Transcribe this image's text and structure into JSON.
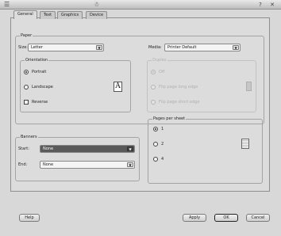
{
  "window": {
    "app_icon": "☃",
    "help_symbol": "?",
    "close_symbol": "✕"
  },
  "tabs": [
    {
      "label": "General",
      "active": true
    },
    {
      "label": "Text",
      "active": false
    },
    {
      "label": "Graphics",
      "active": false
    },
    {
      "label": "Device",
      "active": false
    }
  ],
  "paper": {
    "title": "Paper",
    "size_label": "Size:",
    "size_value": "Letter",
    "media_label": "Media:",
    "media_value": "Printer Default"
  },
  "orientation": {
    "title": "Orientation",
    "portrait": "Portrait",
    "landscape": "Landscape",
    "reverse": "Reverse",
    "preview_glyph": "A"
  },
  "duplex": {
    "title": "Duplex",
    "off": "Off",
    "long_edge": "Flip page long edge",
    "short_edge": "Flip page short edge"
  },
  "banners": {
    "title": "Banners",
    "start_label": "Start:",
    "start_value": "None",
    "end_label": "End:",
    "end_value": "None"
  },
  "pages_per_sheet": {
    "title": "Pages per sheet",
    "options": [
      "1",
      "2",
      "4"
    ]
  },
  "buttons": {
    "help": "Help",
    "apply": "Apply",
    "ok": "OK",
    "cancel": "Cancel"
  }
}
